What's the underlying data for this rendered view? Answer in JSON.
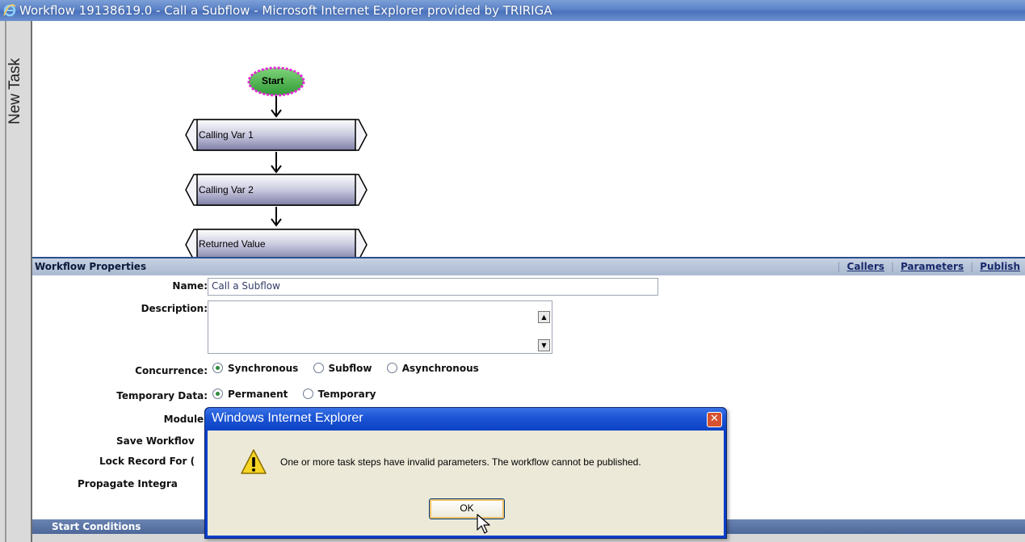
{
  "window": {
    "title": "Workflow 19138619.0 - Call a Subflow - Microsoft Internet Explorer provided by TRIRIGA",
    "icon": "ie-icon"
  },
  "side_tab": {
    "label": "New Task"
  },
  "workflow": {
    "start_label": "Start",
    "steps": [
      {
        "label": "Calling Var 1"
      },
      {
        "label": "Calling Var 2"
      },
      {
        "label": "Returned Value"
      }
    ]
  },
  "properties": {
    "header": "Workflow Properties",
    "links": {
      "callers": "Callers",
      "parameters": "Parameters",
      "publish": "Publish"
    },
    "name_label": "Name:",
    "name_value": "Call a Subflow",
    "description_label": "Description:",
    "concurrence_label": "Concurrence:",
    "concurrence_options": {
      "synchronous": "Synchronous",
      "subflow": "Subflow",
      "asynchronous": "Asynchronous"
    },
    "concurrence_selected": "Synchronous",
    "temp_data_label": "Temporary Data:",
    "temp_data_options": {
      "permanent": "Permanent",
      "temporary": "Temporary"
    },
    "temp_data_selected": "Permanent",
    "module_label": "Module:",
    "save_workflow_label": "Save Workflov",
    "lock_record_label": "Lock Record For (",
    "propagate_label": "Propagate Integra"
  },
  "start_conditions": {
    "label": "Start Conditions"
  },
  "dialog": {
    "title": "Windows Internet Explorer",
    "message": "One or more task steps have invalid parameters.  The workflow cannot be published.",
    "ok_label": "OK",
    "colors": {
      "title": "#1d56d6",
      "body": "#ece9d8",
      "close": "#d6512f"
    }
  }
}
